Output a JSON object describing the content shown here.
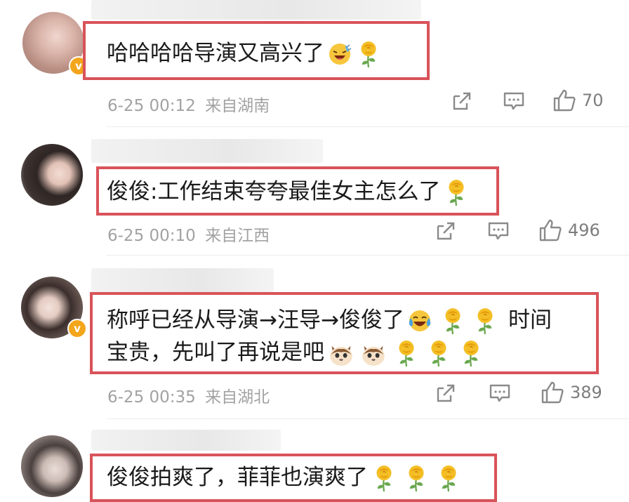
{
  "colors": {
    "highlight_border": "#d9535a",
    "meta_text": "#a2a2a2",
    "verified_badge": "#f3a51b"
  },
  "comments": [
    {
      "avatar": "avatar",
      "verified": true,
      "lines": [
        "哈哈哈哈导演又高兴了"
      ],
      "emoji_after": [
        "laughing-sweat-emoji",
        "yellow-rose-emoji"
      ],
      "date": "6-25 00:12",
      "location": "来自湖南",
      "likes": "70"
    },
    {
      "avatar": "avatar",
      "verified": false,
      "lines": [
        "俊俊:工作结束夸夸最佳女主怎么了"
      ],
      "emoji_after": [
        "yellow-rose-emoji"
      ],
      "date": "6-25 00:10",
      "location": "来自江西",
      "likes": "496"
    },
    {
      "avatar": "avatar",
      "verified": true,
      "lines": [
        "称呼已经从导演→汪导→俊俊了",
        "时间",
        "宝贵，先叫了再说是吧"
      ],
      "emoji_after": [
        "crying-laughing-emoji",
        "yellow-rose-emoji",
        "yellow-rose-emoji",
        "cat-face-emoji",
        "cat-face-emoji",
        "yellow-rose-emoji",
        "yellow-rose-emoji",
        "yellow-rose-emoji"
      ],
      "date": "6-25 00:35",
      "location": "来自湖北",
      "likes": "389"
    },
    {
      "avatar": "avatar",
      "verified": false,
      "lines": [
        "俊俊拍爽了，菲菲也演爽了"
      ],
      "emoji_after": [
        "yellow-rose-emoji",
        "yellow-rose-emoji",
        "yellow-rose-emoji"
      ],
      "date": "",
      "location": "",
      "likes": ""
    }
  ],
  "icons": {
    "share": "share-icon",
    "comment": "comment-icon",
    "like": "thumbs-up-icon"
  }
}
